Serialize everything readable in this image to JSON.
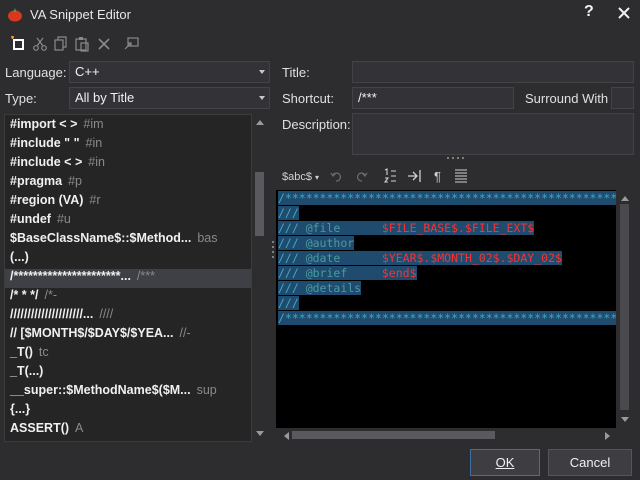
{
  "window": {
    "title": "VA Snippet Editor",
    "help_glyph": "?"
  },
  "toolbar": {
    "icons": [
      "new-snippet-icon",
      "cut-icon",
      "copy-icon",
      "paste-icon",
      "delete-icon",
      "import-icon"
    ]
  },
  "left": {
    "language_label": "Language:",
    "language_value": "C++",
    "type_label": "Type:",
    "type_value": "All by Title",
    "items": [
      {
        "shortcut": "#import < >",
        "title": "#im"
      },
      {
        "shortcut": "#include \" \"",
        "title": "#in"
      },
      {
        "shortcut": "#include < >",
        "title": "#in"
      },
      {
        "shortcut": "#pragma",
        "title": "#p"
      },
      {
        "shortcut": "#region (VA)",
        "title": "#r"
      },
      {
        "shortcut": "#undef",
        "title": "#u"
      },
      {
        "shortcut": "$BaseClassName$::$Method...",
        "title": "bas"
      },
      {
        "shortcut": "(...)",
        "title": ""
      },
      {
        "shortcut": "/**********************...",
        "title": "/***"
      },
      {
        "shortcut": "/* *  */",
        "title": "/*-"
      },
      {
        "shortcut": "/////////////////////...",
        "title": "////"
      },
      {
        "shortcut": "//   [$MONTH$/$DAY$/$YEA...",
        "title": "//-"
      },
      {
        "shortcut": "_T()",
        "title": "tc"
      },
      {
        "shortcut": "_T(...)",
        "title": ""
      },
      {
        "shortcut": "__super::$MethodName$($M...",
        "title": "sup"
      },
      {
        "shortcut": "{...}",
        "title": ""
      },
      {
        "shortcut": "ASSERT()",
        "title": "A"
      }
    ]
  },
  "right": {
    "title_label": "Title:",
    "title_value": "",
    "shortcut_label": "Shortcut:",
    "shortcut_value": "/***",
    "surround_label": "Surround With",
    "description_label": "Description:",
    "description_value": "",
    "editor_toolbar": {
      "reserved_label": "$abc$"
    },
    "code_lines": [
      {
        "parts": [
          {
            "t": "/****************************************************************",
            "c": "c-cm"
          }
        ]
      },
      {
        "parts": [
          {
            "t": "///",
            "c": "c-cm"
          }
        ]
      },
      {
        "parts": [
          {
            "t": "/// ",
            "c": "c-cm"
          },
          {
            "t": "@file      ",
            "c": "c-kw"
          },
          {
            "t": "$FILE_BASE$.$FILE_EXT$",
            "c": "c-var"
          }
        ]
      },
      {
        "parts": [
          {
            "t": "/// ",
            "c": "c-cm"
          },
          {
            "t": "@author",
            "c": "c-kw"
          }
        ]
      },
      {
        "parts": [
          {
            "t": "/// ",
            "c": "c-cm"
          },
          {
            "t": "@date      ",
            "c": "c-kw"
          },
          {
            "t": "$YEAR$.$MONTH_02$.$DAY_02$",
            "c": "c-var"
          }
        ]
      },
      {
        "parts": [
          {
            "t": "/// ",
            "c": "c-cm"
          },
          {
            "t": "@brief     ",
            "c": "c-kw"
          },
          {
            "t": "$end$",
            "c": "c-var"
          }
        ]
      },
      {
        "parts": [
          {
            "t": "/// ",
            "c": "c-cm"
          },
          {
            "t": "@details",
            "c": "c-kw"
          }
        ]
      },
      {
        "parts": [
          {
            "t": "///",
            "c": "c-cm"
          }
        ]
      },
      {
        "parts": [
          {
            "t": "/****************************************************************",
            "c": "c-cm"
          }
        ]
      }
    ]
  },
  "buttons": {
    "ok": "OK",
    "cancel": "Cancel"
  },
  "colors": {
    "background": "#2d2d30",
    "selection": "#1e4b6e",
    "comment": "#3fa9c4",
    "reserved": "#ff3030"
  }
}
